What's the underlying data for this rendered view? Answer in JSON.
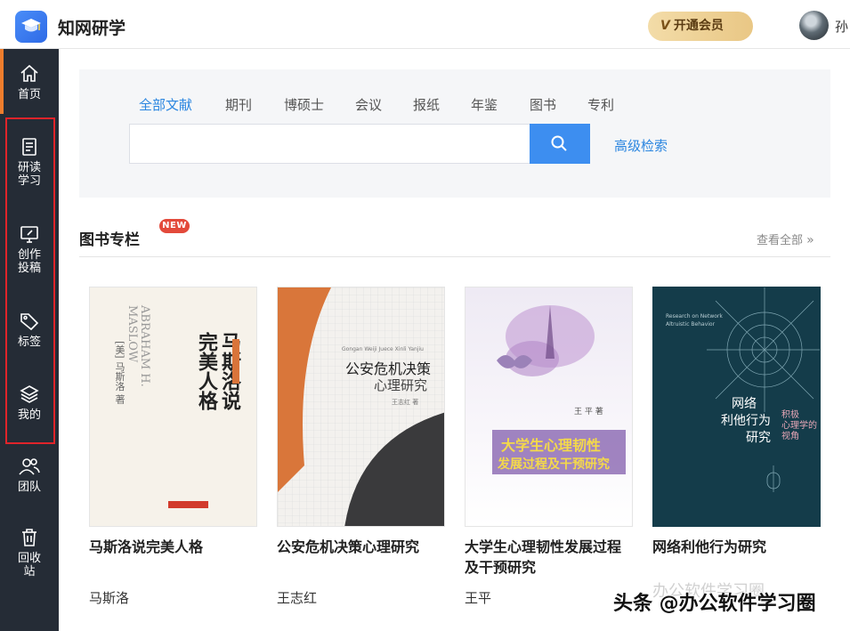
{
  "header": {
    "app_name": "知网研学",
    "vip_label": "开通会员",
    "vip_mark": "V",
    "user_name": "孙"
  },
  "sidebar": {
    "items": [
      {
        "label": "首页",
        "icon": "home-icon"
      },
      {
        "label": "研读\n学习",
        "icon": "document-icon"
      },
      {
        "label": "创作\n投稿",
        "icon": "monitor-pen-icon"
      },
      {
        "label": "标签",
        "icon": "tag-icon"
      },
      {
        "label": "我的",
        "icon": "stack-icon"
      },
      {
        "label": "团队",
        "icon": "team-icon"
      },
      {
        "label": "回收\n站",
        "icon": "trash-icon"
      }
    ]
  },
  "search": {
    "tabs": [
      "全部文献",
      "期刊",
      "博硕士",
      "会议",
      "报纸",
      "年鉴",
      "图书",
      "专利"
    ],
    "active_tab": "全部文献",
    "placeholder": "",
    "value": "",
    "advanced_label": "高级检索"
  },
  "section": {
    "title": "图书专栏",
    "badge": "NEW",
    "view_all": "查看全部"
  },
  "books": [
    {
      "title": "马斯洛说完美人格",
      "author": "马斯洛",
      "cover": {
        "main": "马斯洛说\n完美人格",
        "side": "ABRAHAM H.\nMASLOW",
        "author": "[美] 马斯洛 著"
      }
    },
    {
      "title": "公安危机决策心理研究",
      "author": "王志红",
      "cover": {
        "line1": "公安危机决策",
        "line2": "心理研究",
        "pinyin": "Gongan Weiji Juece Xinli Yanjiu",
        "author": "王志红 著"
      }
    },
    {
      "title": "大学生心理韧性发展过程及干预研究",
      "author": "王平",
      "cover": {
        "line1": "大学生心理韧性",
        "line2": "发展过程及干预研究",
        "author": "王 平 著"
      }
    },
    {
      "title": "网络利他行为研究",
      "author": "",
      "cover": {
        "en": "Research on Network\nAltruistic Behavior",
        "line1": "网络",
        "line2": "利他行为",
        "line3": "研究",
        "sub": "积极\n心理学的\n视角"
      }
    }
  ],
  "watermark": {
    "text": "头条 @办公软件学习圈",
    "faint": "办公软件学习圈"
  },
  "colors": {
    "accent": "#2b86e0",
    "sidebar": "#252c36",
    "highlight": "#e0242a",
    "badge": "#e34a3b"
  }
}
